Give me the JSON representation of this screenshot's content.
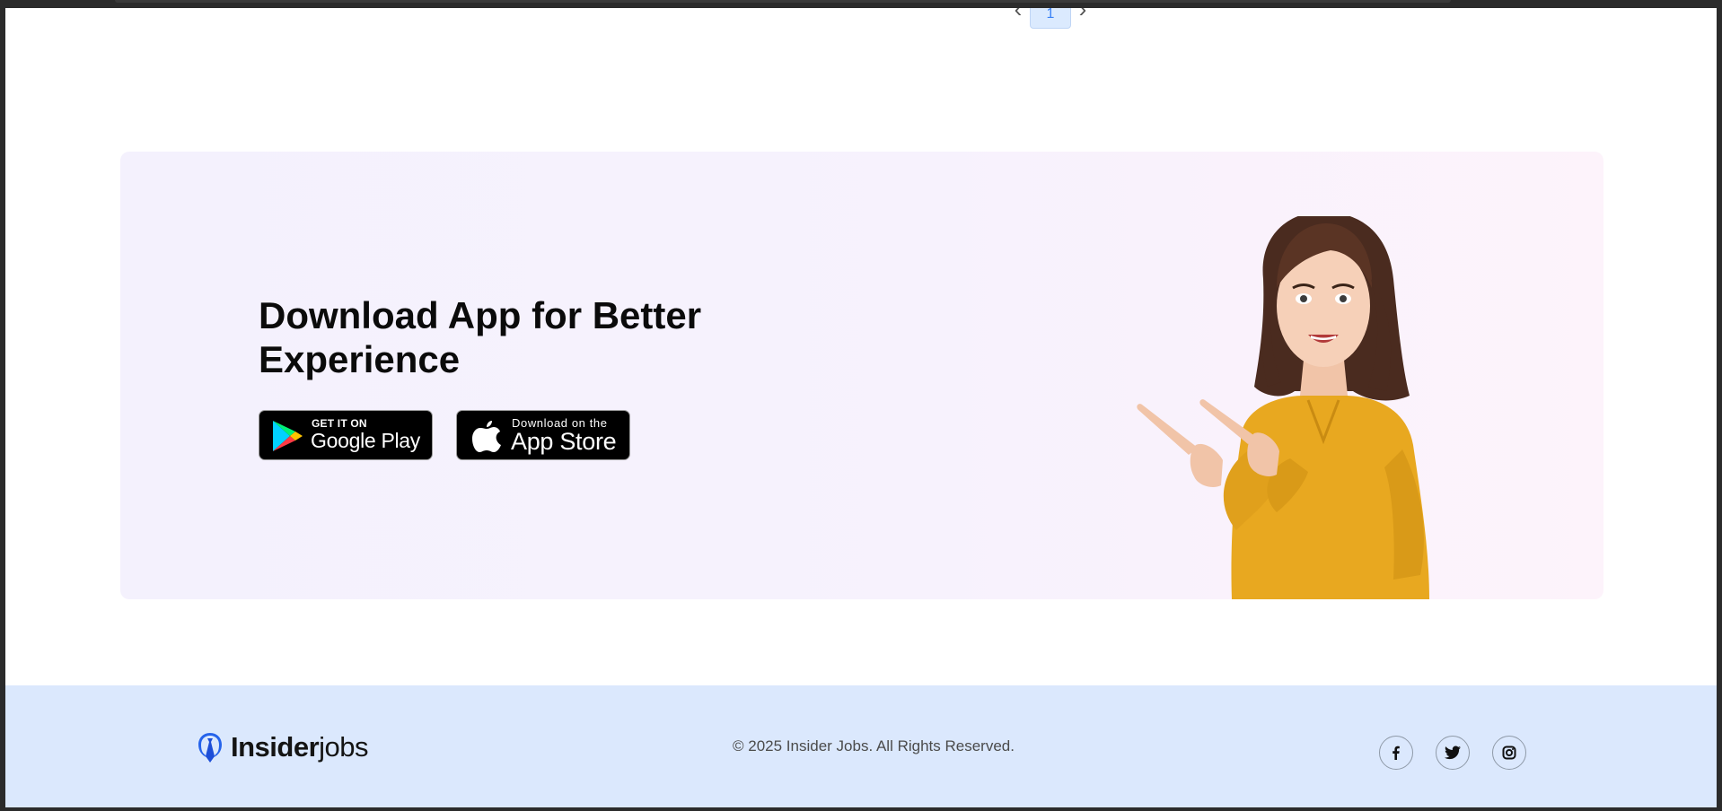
{
  "pagination": {
    "prev_icon": "chevron-left-icon",
    "current_page": "1",
    "next_icon": "chevron-right-icon"
  },
  "banner": {
    "title_line1": "Download App for Better",
    "title_line2": "Experience",
    "google_play": {
      "small": "GET IT ON",
      "big": "Google Play"
    },
    "app_store": {
      "small": "Download on the",
      "big": "App Store"
    }
  },
  "footer": {
    "logo_bold": "Insider",
    "logo_light": "jobs",
    "copyright": "© 2025 Insider Jobs. All Rights Reserved.",
    "social": [
      "facebook-icon",
      "twitter-icon",
      "instagram-icon"
    ]
  },
  "colors": {
    "footer_bg": "#dbe8fd",
    "banner_bg": "#f6f2fd",
    "accent_blue": "#3b82f6",
    "shirt": "#e8a820"
  }
}
